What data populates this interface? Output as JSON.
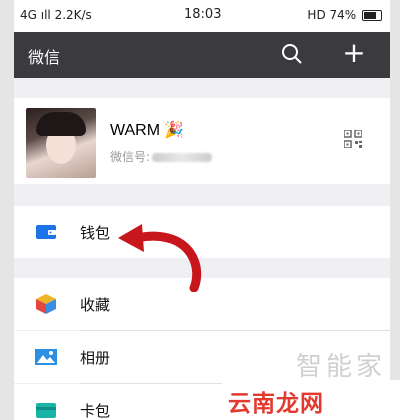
{
  "status_bar": {
    "left": "4G ıll 2.2K/s",
    "time": "18:03",
    "right": "HD 74%"
  },
  "header": {
    "title": "微信"
  },
  "profile": {
    "nickname": "WARM",
    "wechat_id_label": "微信号:"
  },
  "menu": {
    "wallet": "钱包",
    "favorites": "收藏",
    "album": "相册",
    "cards": "卡包"
  },
  "watermark": {
    "top": "智能家",
    "bottom": "云南龙网"
  },
  "colors": {
    "titlebar": "#3b3b3f",
    "wallet": "#1a73e8",
    "arrow": "#c8161d",
    "watermark_red": "#e33a2f"
  }
}
